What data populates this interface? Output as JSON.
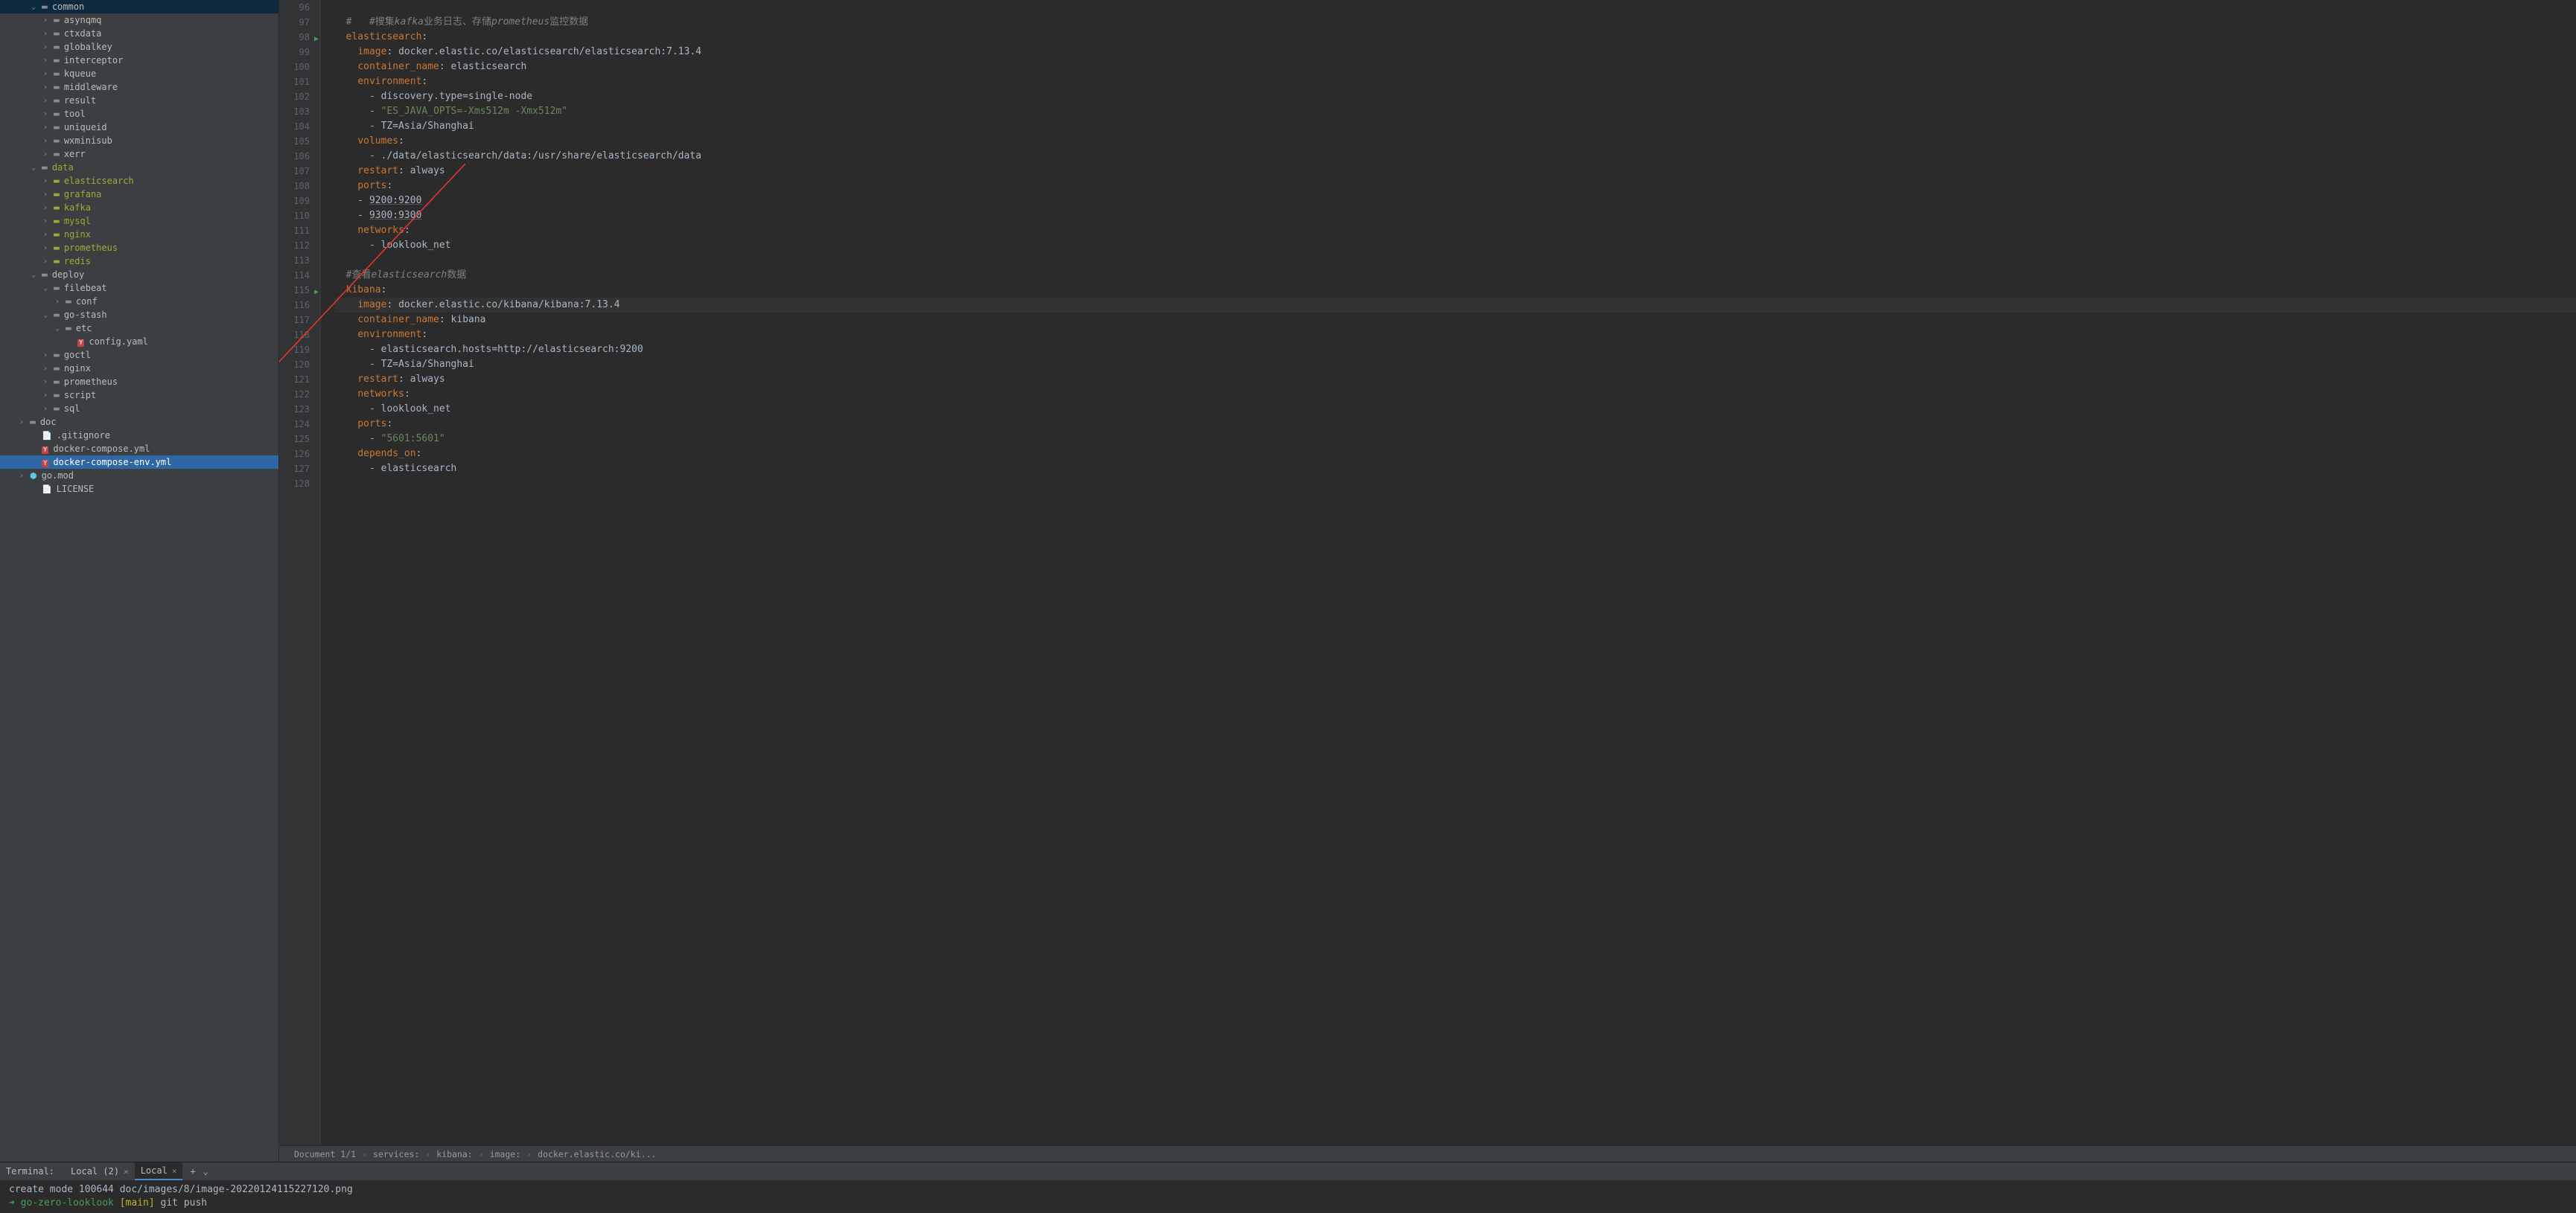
{
  "tree": [
    {
      "indent": 2,
      "chevron": "v",
      "icon": "folder",
      "label": "common"
    },
    {
      "indent": 3,
      "chevron": ">",
      "icon": "folder",
      "label": "asynqmq"
    },
    {
      "indent": 3,
      "chevron": ">",
      "icon": "folder",
      "label": "ctxdata"
    },
    {
      "indent": 3,
      "chevron": ">",
      "icon": "folder",
      "label": "globalkey"
    },
    {
      "indent": 3,
      "chevron": ">",
      "icon": "folder",
      "label": "interceptor"
    },
    {
      "indent": 3,
      "chevron": ">",
      "icon": "folder",
      "label": "kqueue"
    },
    {
      "indent": 3,
      "chevron": ">",
      "icon": "folder",
      "label": "middleware"
    },
    {
      "indent": 3,
      "chevron": ">",
      "icon": "folder",
      "label": "result"
    },
    {
      "indent": 3,
      "chevron": ">",
      "icon": "folder",
      "label": "tool"
    },
    {
      "indent": 3,
      "chevron": ">",
      "icon": "folder",
      "label": "uniqueid"
    },
    {
      "indent": 3,
      "chevron": ">",
      "icon": "folder",
      "label": "wxminisub"
    },
    {
      "indent": 3,
      "chevron": ">",
      "icon": "folder",
      "label": "xerr"
    },
    {
      "indent": 2,
      "chevron": "v",
      "icon": "folder",
      "label": "data",
      "olive": true
    },
    {
      "indent": 3,
      "chevron": ">",
      "icon": "folder-olive",
      "label": "elasticsearch",
      "olive": true
    },
    {
      "indent": 3,
      "chevron": ">",
      "icon": "folder-olive",
      "label": "grafana",
      "olive": true
    },
    {
      "indent": 3,
      "chevron": ">",
      "icon": "folder-olive",
      "label": "kafka",
      "olive": true
    },
    {
      "indent": 3,
      "chevron": ">",
      "icon": "folder-olive",
      "label": "mysql",
      "olive": true
    },
    {
      "indent": 3,
      "chevron": ">",
      "icon": "folder-olive",
      "label": "nginx",
      "olive": true
    },
    {
      "indent": 3,
      "chevron": ">",
      "icon": "folder-olive",
      "label": "prometheus",
      "olive": true
    },
    {
      "indent": 3,
      "chevron": ">",
      "icon": "folder-olive",
      "label": "redis",
      "olive": true
    },
    {
      "indent": 2,
      "chevron": "v",
      "icon": "folder",
      "label": "deploy"
    },
    {
      "indent": 3,
      "chevron": "v",
      "icon": "folder",
      "label": "filebeat"
    },
    {
      "indent": 4,
      "chevron": ">",
      "icon": "folder",
      "label": "conf"
    },
    {
      "indent": 3,
      "chevron": "v",
      "icon": "folder",
      "label": "go-stash"
    },
    {
      "indent": 4,
      "chevron": "v",
      "icon": "folder",
      "label": "etc"
    },
    {
      "indent": 5,
      "chevron": "",
      "icon": "yaml",
      "label": "config.yaml"
    },
    {
      "indent": 3,
      "chevron": ">",
      "icon": "folder",
      "label": "goctl"
    },
    {
      "indent": 3,
      "chevron": ">",
      "icon": "folder",
      "label": "nginx"
    },
    {
      "indent": 3,
      "chevron": ">",
      "icon": "folder",
      "label": "prometheus"
    },
    {
      "indent": 3,
      "chevron": ">",
      "icon": "folder",
      "label": "script"
    },
    {
      "indent": 3,
      "chevron": ">",
      "icon": "folder",
      "label": "sql"
    },
    {
      "indent": 1,
      "chevron": ">",
      "icon": "folder",
      "label": "doc"
    },
    {
      "indent": 2,
      "chevron": "",
      "icon": "file",
      "label": ".gitignore"
    },
    {
      "indent": 2,
      "chevron": "",
      "icon": "yaml",
      "label": "docker-compose.yml"
    },
    {
      "indent": 2,
      "chevron": "",
      "icon": "yaml",
      "label": "docker-compose-env.yml",
      "selected": true
    },
    {
      "indent": 1,
      "chevron": ">",
      "icon": "go",
      "label": "go.mod"
    },
    {
      "indent": 2,
      "chevron": "",
      "icon": "file",
      "label": "LICENSE"
    }
  ],
  "gutter_start": 96,
  "gutter_end": 128,
  "run_markers": [
    98,
    115
  ],
  "current_line_num": 116,
  "code_lines": [
    {
      "n": 96,
      "tokens": []
    },
    {
      "n": 97,
      "tokens": [
        {
          "t": "  ",
          "c": ""
        },
        {
          "t": "#   #搜集",
          "c": "c-comment"
        },
        {
          "t": "kafka",
          "c": "c-comment c-italic"
        },
        {
          "t": "业务日志、存储",
          "c": "c-comment"
        },
        {
          "t": "prometheus",
          "c": "c-comment c-italic"
        },
        {
          "t": "监控数据",
          "c": "c-comment"
        }
      ]
    },
    {
      "n": 98,
      "tokens": [
        {
          "t": "  ",
          "c": ""
        },
        {
          "t": "elasticsearch",
          "c": "c-key"
        },
        {
          "t": ":",
          "c": "c-val"
        }
      ]
    },
    {
      "n": 99,
      "tokens": [
        {
          "t": "    ",
          "c": ""
        },
        {
          "t": "image",
          "c": "c-key"
        },
        {
          "t": ": docker.elastic.co/elasticsearch/elasticsearch:7.13.4",
          "c": "c-val"
        }
      ]
    },
    {
      "n": 100,
      "tokens": [
        {
          "t": "    ",
          "c": ""
        },
        {
          "t": "container_name",
          "c": "c-key"
        },
        {
          "t": ": elasticsearch",
          "c": "c-val"
        }
      ]
    },
    {
      "n": 101,
      "tokens": [
        {
          "t": "    ",
          "c": ""
        },
        {
          "t": "environment",
          "c": "c-key"
        },
        {
          "t": ":",
          "c": "c-val"
        }
      ]
    },
    {
      "n": 102,
      "tokens": [
        {
          "t": "      - discovery.type=single-node",
          "c": "c-val"
        }
      ]
    },
    {
      "n": 103,
      "tokens": [
        {
          "t": "      - ",
          "c": "c-val"
        },
        {
          "t": "\"ES_JAVA_OPTS=-Xms512m -Xmx512m\"",
          "c": "c-str"
        }
      ]
    },
    {
      "n": 104,
      "tokens": [
        {
          "t": "      - TZ=Asia/Shanghai",
          "c": "c-val"
        }
      ]
    },
    {
      "n": 105,
      "tokens": [
        {
          "t": "    ",
          "c": ""
        },
        {
          "t": "volumes",
          "c": "c-key"
        },
        {
          "t": ":",
          "c": "c-val"
        }
      ]
    },
    {
      "n": 106,
      "tokens": [
        {
          "t": "      - ./data/elasticsearch/data:/usr/share/elasticsearch/data",
          "c": "c-val"
        }
      ]
    },
    {
      "n": 107,
      "tokens": [
        {
          "t": "    ",
          "c": ""
        },
        {
          "t": "restart",
          "c": "c-key"
        },
        {
          "t": ": always",
          "c": "c-val"
        }
      ]
    },
    {
      "n": 108,
      "tokens": [
        {
          "t": "    ",
          "c": ""
        },
        {
          "t": "ports",
          "c": "c-key"
        },
        {
          "t": ":",
          "c": "c-val"
        }
      ]
    },
    {
      "n": 109,
      "tokens": [
        {
          "t": "    - ",
          "c": "c-val"
        },
        {
          "t": "9200:9200",
          "c": "c-val c-underline"
        }
      ]
    },
    {
      "n": 110,
      "tokens": [
        {
          "t": "    - ",
          "c": "c-val"
        },
        {
          "t": "9300:9300",
          "c": "c-val c-underline"
        }
      ]
    },
    {
      "n": 111,
      "tokens": [
        {
          "t": "    ",
          "c": ""
        },
        {
          "t": "networks",
          "c": "c-key"
        },
        {
          "t": ":",
          "c": "c-val"
        }
      ]
    },
    {
      "n": 112,
      "tokens": [
        {
          "t": "      - looklook_net",
          "c": "c-val"
        }
      ]
    },
    {
      "n": 113,
      "tokens": []
    },
    {
      "n": 114,
      "tokens": [
        {
          "t": "  ",
          "c": ""
        },
        {
          "t": "#查看",
          "c": "c-comment"
        },
        {
          "t": "elasticsearch",
          "c": "c-comment c-italic"
        },
        {
          "t": "数据",
          "c": "c-comment"
        }
      ]
    },
    {
      "n": 115,
      "tokens": [
        {
          "t": "  ",
          "c": ""
        },
        {
          "t": "kibana",
          "c": "c-key"
        },
        {
          "t": ":",
          "c": "c-val"
        }
      ]
    },
    {
      "n": 116,
      "tokens": [
        {
          "t": "    ",
          "c": ""
        },
        {
          "t": "image",
          "c": "c-key"
        },
        {
          "t": ": docker.elastic.co/kibana/kibana:7.13.4",
          "c": "c-val"
        }
      ],
      "current": true
    },
    {
      "n": 117,
      "tokens": [
        {
          "t": "    ",
          "c": ""
        },
        {
          "t": "container_name",
          "c": "c-key"
        },
        {
          "t": ": kibana",
          "c": "c-val"
        }
      ]
    },
    {
      "n": 118,
      "tokens": [
        {
          "t": "    ",
          "c": ""
        },
        {
          "t": "environment",
          "c": "c-key"
        },
        {
          "t": ":",
          "c": "c-val"
        }
      ]
    },
    {
      "n": 119,
      "tokens": [
        {
          "t": "      - elasticsearch.hosts=http://elasticsearch:9200",
          "c": "c-val"
        }
      ]
    },
    {
      "n": 120,
      "tokens": [
        {
          "t": "      - TZ=Asia/Shanghai",
          "c": "c-val"
        }
      ]
    },
    {
      "n": 121,
      "tokens": [
        {
          "t": "    ",
          "c": ""
        },
        {
          "t": "restart",
          "c": "c-key"
        },
        {
          "t": ": always",
          "c": "c-val"
        }
      ]
    },
    {
      "n": 122,
      "tokens": [
        {
          "t": "    ",
          "c": ""
        },
        {
          "t": "networks",
          "c": "c-key"
        },
        {
          "t": ":",
          "c": "c-val"
        }
      ]
    },
    {
      "n": 123,
      "tokens": [
        {
          "t": "      - looklook_net",
          "c": "c-val"
        }
      ]
    },
    {
      "n": 124,
      "tokens": [
        {
          "t": "    ",
          "c": ""
        },
        {
          "t": "ports",
          "c": "c-key"
        },
        {
          "t": ":",
          "c": "c-val"
        }
      ]
    },
    {
      "n": 125,
      "tokens": [
        {
          "t": "      - ",
          "c": "c-val"
        },
        {
          "t": "\"5601:5601\"",
          "c": "c-str"
        }
      ]
    },
    {
      "n": 126,
      "tokens": [
        {
          "t": "    ",
          "c": ""
        },
        {
          "t": "depends_on",
          "c": "c-key"
        },
        {
          "t": ":",
          "c": "c-val"
        }
      ]
    },
    {
      "n": 127,
      "tokens": [
        {
          "t": "      - elasticsearch",
          "c": "c-val"
        }
      ]
    },
    {
      "n": 128,
      "tokens": []
    }
  ],
  "breadcrumb": {
    "doc": "Document 1/1",
    "parts": [
      "services:",
      "kibana:",
      "image:",
      "docker.elastic.co/ki..."
    ]
  },
  "terminal": {
    "label": "Terminal:",
    "tab1": "Local (2)",
    "tab2": "Local",
    "line1": "create mode 100644 doc/images/8/image-20220124115227120.png",
    "prompt_host": "go-zero-looklook",
    "prompt_branch": "[main]",
    "prompt_cmd": "git push"
  }
}
